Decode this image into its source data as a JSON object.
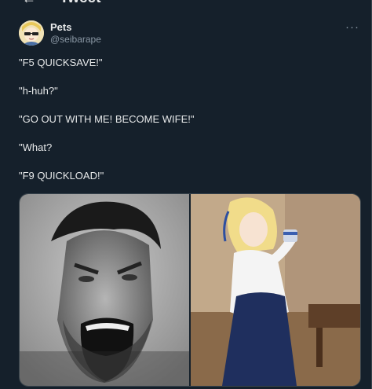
{
  "header": {
    "back_icon": "arrow-left-icon",
    "title": "Tweet"
  },
  "tweet": {
    "author_name": "Pets",
    "author_handle": "@seibarape",
    "more_icon": "more-horizontal-icon",
    "lines": [
      "\"F5 QUICKSAVE!\"",
      "\"h-huh?\"",
      "\"GO OUT WITH ME! BECOME WIFE!\"",
      "\"What?",
      "\"F9 QUICKLOAD!\""
    ],
    "media": [
      {
        "kind": "photo",
        "description_icon": "screaming-man-photo"
      },
      {
        "kind": "photo",
        "description_icon": "cosplay-woman-photo"
      }
    ]
  },
  "colors": {
    "background": "#15202b",
    "text": "#e7e9ea",
    "muted": "#8b98a5",
    "border": "#38444d"
  }
}
